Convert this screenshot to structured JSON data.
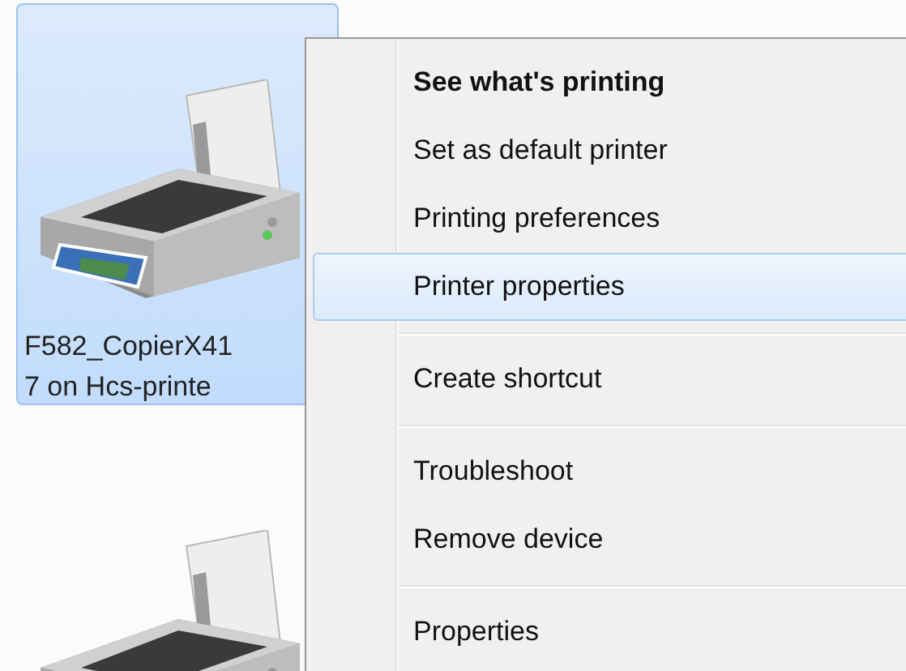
{
  "devices": [
    {
      "label_lines": [
        "F582_CopierX41",
        "7 on Hcs-printe"
      ],
      "selected": true
    },
    {
      "selected": false
    }
  ],
  "context_menu": {
    "items": [
      {
        "kind": "item",
        "label": "See what's printing",
        "default": true,
        "selected": false
      },
      {
        "kind": "item",
        "label": "Set as default printer",
        "default": false,
        "selected": false
      },
      {
        "kind": "item",
        "label": "Printing preferences",
        "default": false,
        "selected": false
      },
      {
        "kind": "item",
        "label": "Printer properties",
        "default": false,
        "selected": true
      },
      {
        "kind": "separator"
      },
      {
        "kind": "item",
        "label": "Create shortcut",
        "default": false,
        "selected": false
      },
      {
        "kind": "separator"
      },
      {
        "kind": "item",
        "label": "Troubleshoot",
        "default": false,
        "selected": false
      },
      {
        "kind": "item",
        "label": "Remove device",
        "default": false,
        "selected": false
      },
      {
        "kind": "separator"
      },
      {
        "kind": "item",
        "label": "Properties",
        "default": false,
        "selected": false
      }
    ]
  }
}
